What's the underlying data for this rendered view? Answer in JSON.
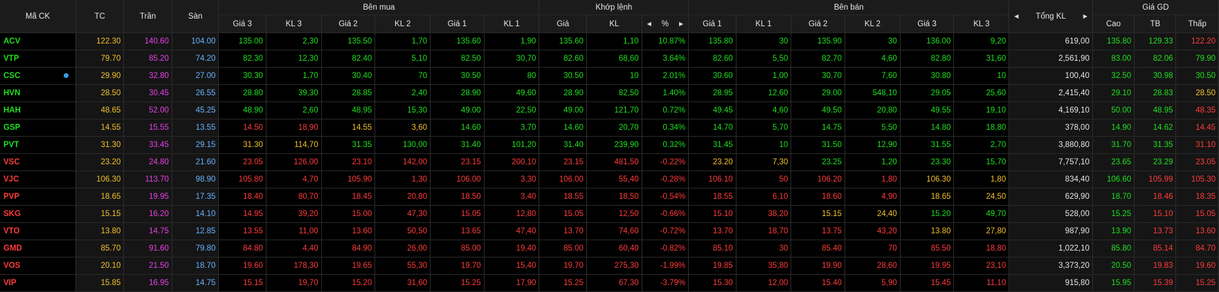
{
  "colors": {
    "up": "#1fe01f",
    "down": "#ff3b3b",
    "ref": "#f2c12e",
    "ceil": "#e740e7",
    "floor": "#66b3ff"
  },
  "header": {
    "ma_ck": "Mã CK",
    "tc": "TC",
    "tran": "Trần",
    "san": "Sàn",
    "ben_mua": "Bên mua",
    "khop_lenh": "Khớp lệnh",
    "ben_ban": "Bên bán",
    "tong_kl": "Tổng KL",
    "gia_gd": "Giá GD",
    "gia3": "Giá 3",
    "kl3": "KL 3",
    "gia2": "Giá 2",
    "kl2": "KL 2",
    "gia1": "Giá 1",
    "kl1": "KL 1",
    "gia": "Giá",
    "kl": "KL",
    "pct": "%",
    "cao": "Cao",
    "tb": "TB",
    "thap": "Thấp",
    "arrow_left_icon": "◀",
    "arrow_right_icon": "▶"
  },
  "rows": [
    {
      "sym": "ACV",
      "tc": "122.30",
      "tran": "140.60",
      "san": "104.00",
      "b3": "135.00",
      "bk3": "2,30",
      "b2": "135.50",
      "bk2": "1,70",
      "b1": "135.60",
      "bk1": "1,90",
      "m": "135.60",
      "mk": "1,10",
      "pct": "10.87%",
      "s1": "135.80",
      "sk1": "30",
      "s2": "135.90",
      "sk2": "30",
      "s3": "136.00",
      "sk3": "9,20",
      "tot": "619,00",
      "hi": "135.80",
      "avg": "129.33",
      "lo": "122.20",
      "cl": {
        "sym": "up",
        "b3": "up",
        "b2": "up",
        "b1": "up",
        "m": "up",
        "s1": "up",
        "s2": "up",
        "s3": "up",
        "hi": "up",
        "avg": "up",
        "lo": "down"
      }
    },
    {
      "sym": "VTP",
      "tc": "79.70",
      "tran": "85.20",
      "san": "74.20",
      "b3": "82.30",
      "bk3": "12,30",
      "b2": "82.40",
      "bk2": "5,10",
      "b1": "82.50",
      "bk1": "30,70",
      "m": "82.60",
      "mk": "68,60",
      "pct": "3.64%",
      "s1": "82.60",
      "sk1": "5,50",
      "s2": "82.70",
      "sk2": "4,60",
      "s3": "82.80",
      "sk3": "31,60",
      "tot": "2,561,90",
      "hi": "83.00",
      "avg": "82.06",
      "lo": "79.90",
      "cl": {
        "sym": "up",
        "b3": "up",
        "b2": "up",
        "b1": "up",
        "m": "up",
        "s1": "up",
        "s2": "up",
        "s3": "up",
        "hi": "up",
        "avg": "up",
        "lo": "up"
      }
    },
    {
      "sym": "CSC",
      "tc": "29.90",
      "tran": "32.80",
      "san": "27.00",
      "b3": "30.30",
      "bk3": "1,70",
      "b2": "30.40",
      "bk2": "70",
      "b1": "30.50",
      "bk1": "80",
      "m": "30.50",
      "mk": "10",
      "pct": "2.01%",
      "s1": "30.60",
      "sk1": "1,00",
      "s2": "30.70",
      "sk2": "7,60",
      "s3": "30.80",
      "sk3": "10",
      "tot": "100,40",
      "hi": "32.50",
      "avg": "30.98",
      "lo": "30.50",
      "info": true,
      "cl": {
        "sym": "up",
        "b3": "up",
        "b2": "up",
        "b1": "up",
        "m": "up",
        "s1": "up",
        "s2": "up",
        "s3": "up",
        "hi": "up",
        "avg": "up",
        "lo": "up"
      }
    },
    {
      "sym": "HVN",
      "tc": "28.50",
      "tran": "30.45",
      "san": "26.55",
      "b3": "28.80",
      "bk3": "39,30",
      "b2": "28.85",
      "bk2": "2,40",
      "b1": "28.90",
      "bk1": "49,60",
      "m": "28.90",
      "mk": "82,50",
      "pct": "1.40%",
      "s1": "28.95",
      "sk1": "12,60",
      "s2": "29.00",
      "sk2": "548,10",
      "s3": "29.05",
      "sk3": "25,60",
      "tot": "2,415,40",
      "hi": "29.10",
      "avg": "28.83",
      "lo": "28.50",
      "cl": {
        "sym": "up",
        "b3": "up",
        "b2": "up",
        "b1": "up",
        "m": "up",
        "s1": "up",
        "s2": "up",
        "s3": "up",
        "hi": "up",
        "avg": "up",
        "lo": "ref"
      }
    },
    {
      "sym": "HAH",
      "tc": "48.65",
      "tran": "52.00",
      "san": "45.25",
      "b3": "48.90",
      "bk3": "2,60",
      "b2": "48.95",
      "bk2": "15,30",
      "b1": "49.00",
      "bk1": "22,50",
      "m": "49.00",
      "mk": "121,70",
      "pct": "0.72%",
      "s1": "49.45",
      "sk1": "4,60",
      "s2": "49.50",
      "sk2": "20,80",
      "s3": "49.55",
      "sk3": "19,10",
      "tot": "4,169,10",
      "hi": "50.00",
      "avg": "48.95",
      "lo": "48.35",
      "cl": {
        "sym": "up",
        "b3": "up",
        "b2": "up",
        "b1": "up",
        "m": "up",
        "s1": "up",
        "s2": "up",
        "s3": "up",
        "hi": "up",
        "avg": "up",
        "lo": "down"
      }
    },
    {
      "sym": "GSP",
      "tc": "14.55",
      "tran": "15.55",
      "san": "13.55",
      "b3": "14.50",
      "bk3": "18,90",
      "b2": "14.55",
      "bk2": "3,60",
      "b1": "14.60",
      "bk1": "3,70",
      "m": "14.60",
      "mk": "20,70",
      "pct": "0.34%",
      "s1": "14.70",
      "sk1": "5,70",
      "s2": "14.75",
      "sk2": "5,50",
      "s3": "14.80",
      "sk3": "18,80",
      "tot": "378,00",
      "hi": "14.90",
      "avg": "14.62",
      "lo": "14.45",
      "cl": {
        "sym": "up",
        "b3": "down",
        "b2": "ref",
        "b1": "up",
        "m": "up",
        "s1": "up",
        "s2": "up",
        "s3": "up",
        "hi": "up",
        "avg": "up",
        "lo": "down"
      }
    },
    {
      "sym": "PVT",
      "tc": "31.30",
      "tran": "33.45",
      "san": "29.15",
      "b3": "31.30",
      "bk3": "114,70",
      "b2": "31.35",
      "bk2": "130,00",
      "b1": "31.40",
      "bk1": "101,20",
      "m": "31.40",
      "mk": "239,90",
      "pct": "0.32%",
      "s1": "31.45",
      "sk1": "10",
      "s2": "31.50",
      "sk2": "12,90",
      "s3": "31.55",
      "sk3": "2,70",
      "tot": "3,880,80",
      "hi": "31.70",
      "avg": "31.35",
      "lo": "31.10",
      "cl": {
        "sym": "up",
        "b3": "ref",
        "b2": "up",
        "b1": "up",
        "m": "up",
        "s1": "up",
        "s2": "up",
        "s3": "up",
        "hi": "up",
        "avg": "up",
        "lo": "down"
      }
    },
    {
      "sym": "VSC",
      "tc": "23.20",
      "tran": "24.80",
      "san": "21.60",
      "b3": "23.05",
      "bk3": "126,00",
      "b2": "23.10",
      "bk2": "142,00",
      "b1": "23.15",
      "bk1": "200,10",
      "m": "23.15",
      "mk": "481,50",
      "pct": "-0.22%",
      "s1": "23.20",
      "sk1": "7,30",
      "s2": "23.25",
      "sk2": "1,20",
      "s3": "23.30",
      "sk3": "15,70",
      "tot": "7,757,10",
      "hi": "23.65",
      "avg": "23.29",
      "lo": "23.05",
      "cl": {
        "sym": "down",
        "b3": "down",
        "b2": "down",
        "b1": "down",
        "m": "down",
        "s1": "ref",
        "s2": "up",
        "s3": "up",
        "hi": "up",
        "avg": "up",
        "lo": "down"
      }
    },
    {
      "sym": "VJC",
      "tc": "106.30",
      "tran": "113.70",
      "san": "98.90",
      "b3": "105.80",
      "bk3": "4,70",
      "b2": "105.90",
      "bk2": "1,30",
      "b1": "106.00",
      "bk1": "3,30",
      "m": "106.00",
      "mk": "55,40",
      "pct": "-0.28%",
      "s1": "106.10",
      "sk1": "50",
      "s2": "106.20",
      "sk2": "1,80",
      "s3": "106.30",
      "sk3": "1,80",
      "tot": "834,40",
      "hi": "106.60",
      "avg": "105.99",
      "lo": "105.30",
      "cl": {
        "sym": "down",
        "b3": "down",
        "b2": "down",
        "b1": "down",
        "m": "down",
        "s1": "down",
        "s2": "down",
        "s3": "ref",
        "hi": "up",
        "avg": "down",
        "lo": "down"
      }
    },
    {
      "sym": "PVP",
      "tc": "18.65",
      "tran": "19.95",
      "san": "17.35",
      "b3": "18.40",
      "bk3": "80,70",
      "b2": "18.45",
      "bk2": "20,80",
      "b1": "18.50",
      "bk1": "3,40",
      "m": "18.55",
      "mk": "18,50",
      "pct": "-0.54%",
      "s1": "18.55",
      "sk1": "6,10",
      "s2": "18.60",
      "sk2": "4,90",
      "s3": "18.65",
      "sk3": "24,50",
      "tot": "629,90",
      "hi": "18.70",
      "avg": "18.46",
      "lo": "18.35",
      "cl": {
        "sym": "down",
        "b3": "down",
        "b2": "down",
        "b1": "down",
        "m": "down",
        "s1": "down",
        "s2": "down",
        "s3": "ref",
        "hi": "up",
        "avg": "down",
        "lo": "down"
      }
    },
    {
      "sym": "SKG",
      "tc": "15.15",
      "tran": "16.20",
      "san": "14.10",
      "b3": "14.95",
      "bk3": "39,20",
      "b2": "15.00",
      "bk2": "47,30",
      "b1": "15.05",
      "bk1": "12,80",
      "m": "15.05",
      "mk": "12,50",
      "pct": "-0.66%",
      "s1": "15.10",
      "sk1": "38,20",
      "s2": "15.15",
      "sk2": "24,40",
      "s3": "15.20",
      "sk3": "49,70",
      "tot": "528,00",
      "hi": "15.25",
      "avg": "15.10",
      "lo": "15.05",
      "cl": {
        "sym": "down",
        "b3": "down",
        "b2": "down",
        "b1": "down",
        "m": "down",
        "s1": "down",
        "s2": "ref",
        "s3": "up",
        "hi": "up",
        "avg": "down",
        "lo": "down"
      }
    },
    {
      "sym": "VTO",
      "tc": "13.80",
      "tran": "14.75",
      "san": "12.85",
      "b3": "13.55",
      "bk3": "11,00",
      "b2": "13.60",
      "bk2": "50,50",
      "b1": "13.65",
      "bk1": "47,40",
      "m": "13.70",
      "mk": "74,60",
      "pct": "-0.72%",
      "s1": "13.70",
      "sk1": "18,70",
      "s2": "13.75",
      "sk2": "43,20",
      "s3": "13.80",
      "sk3": "27,80",
      "tot": "987,90",
      "hi": "13.90",
      "avg": "13.73",
      "lo": "13.60",
      "cl": {
        "sym": "down",
        "b3": "down",
        "b2": "down",
        "b1": "down",
        "m": "down",
        "s1": "down",
        "s2": "down",
        "s3": "ref",
        "hi": "up",
        "avg": "down",
        "lo": "down"
      }
    },
    {
      "sym": "GMD",
      "tc": "85.70",
      "tran": "91.60",
      "san": "79.80",
      "b3": "84.80",
      "bk3": "4,40",
      "b2": "84.90",
      "bk2": "26,00",
      "b1": "85.00",
      "bk1": "19,40",
      "m": "85.00",
      "mk": "60,40",
      "pct": "-0.82%",
      "s1": "85.10",
      "sk1": "30",
      "s2": "85.40",
      "sk2": "70",
      "s3": "85.50",
      "sk3": "18,80",
      "tot": "1,022,10",
      "hi": "85.80",
      "avg": "85.14",
      "lo": "84.70",
      "cl": {
        "sym": "down",
        "b3": "down",
        "b2": "down",
        "b1": "down",
        "m": "down",
        "s1": "down",
        "s2": "down",
        "s3": "down",
        "hi": "up",
        "avg": "down",
        "lo": "down"
      }
    },
    {
      "sym": "VOS",
      "tc": "20.10",
      "tran": "21.50",
      "san": "18.70",
      "b3": "19.60",
      "bk3": "178,30",
      "b2": "19.65",
      "bk2": "55,30",
      "b1": "19.70",
      "bk1": "15,40",
      "m": "19.70",
      "mk": "275,30",
      "pct": "-1.99%",
      "s1": "19.85",
      "sk1": "35,80",
      "s2": "19.90",
      "sk2": "28,60",
      "s3": "19.95",
      "sk3": "23,10",
      "tot": "3,373,20",
      "hi": "20.50",
      "avg": "19.83",
      "lo": "19.60",
      "cl": {
        "sym": "down",
        "b3": "down",
        "b2": "down",
        "b1": "down",
        "m": "down",
        "s1": "down",
        "s2": "down",
        "s3": "down",
        "hi": "up",
        "avg": "down",
        "lo": "down"
      }
    },
    {
      "sym": "VIP",
      "tc": "15.85",
      "tran": "16.95",
      "san": "14.75",
      "b3": "15.15",
      "bk3": "19,70",
      "b2": "15.20",
      "bk2": "31,60",
      "b1": "15.25",
      "bk1": "17,90",
      "m": "15.25",
      "mk": "67,30",
      "pct": "-3.79%",
      "s1": "15.30",
      "sk1": "12,00",
      "s2": "15.40",
      "sk2": "5,90",
      "s3": "15.45",
      "sk3": "11,10",
      "tot": "915,80",
      "hi": "15.95",
      "avg": "15.39",
      "lo": "15.25",
      "cl": {
        "sym": "down",
        "b3": "down",
        "b2": "down",
        "b1": "down",
        "m": "down",
        "s1": "down",
        "s2": "down",
        "s3": "down",
        "hi": "up",
        "avg": "down",
        "lo": "down"
      }
    }
  ]
}
